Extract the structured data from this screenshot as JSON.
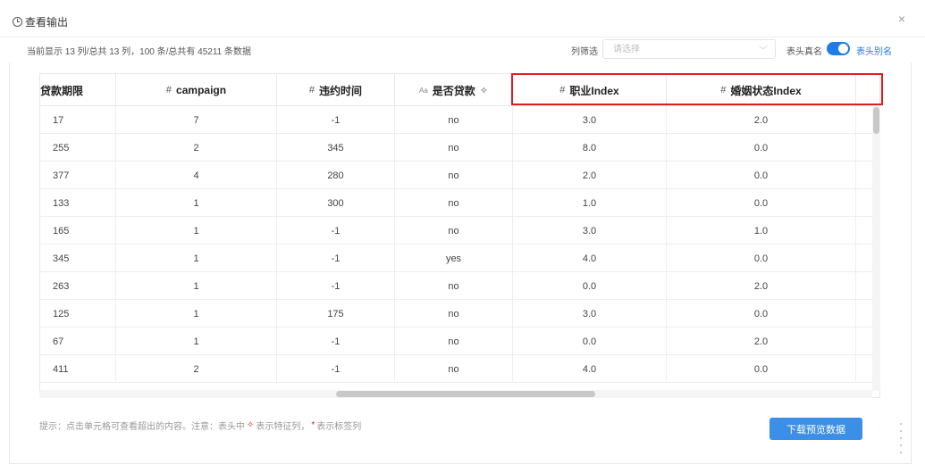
{
  "dialog": {
    "title": "查看输出",
    "close_label": "×"
  },
  "toolbar": {
    "summary": "当前显示 13 列/总共 13 列，100 条/总共有 45211 条数据",
    "column_filter_label": "列筛选",
    "column_filter_placeholder": "请选择",
    "real_name_label": "表头真名",
    "alias_label": "表头别名",
    "alias_toggle_on": true
  },
  "table": {
    "columns": [
      {
        "label": "贷款期限",
        "type_icon": ""
      },
      {
        "label": "campaign",
        "type_icon": "#"
      },
      {
        "label": "违约时间",
        "type_icon": "#"
      },
      {
        "label": "是否贷款",
        "type_icon": "Aa"
      },
      {
        "label": "职业Index",
        "type_icon": "#"
      },
      {
        "label": "婚姻状态Index",
        "type_icon": "#"
      }
    ],
    "rows": [
      [
        "17",
        "7",
        "-1",
        "no",
        "3.0",
        "2.0"
      ],
      [
        "255",
        "2",
        "345",
        "no",
        "8.0",
        "0.0"
      ],
      [
        "377",
        "4",
        "280",
        "no",
        "2.0",
        "0.0"
      ],
      [
        "133",
        "1",
        "300",
        "no",
        "1.0",
        "0.0"
      ],
      [
        "165",
        "1",
        "-1",
        "no",
        "3.0",
        "1.0"
      ],
      [
        "345",
        "1",
        "-1",
        "yes",
        "4.0",
        "0.0"
      ],
      [
        "263",
        "1",
        "-1",
        "no",
        "0.0",
        "2.0"
      ],
      [
        "125",
        "1",
        "175",
        "no",
        "3.0",
        "0.0"
      ],
      [
        "67",
        "1",
        "-1",
        "no",
        "0.0",
        "2.0"
      ],
      [
        "411",
        "2",
        "-1",
        "no",
        "4.0",
        "0.0"
      ]
    ]
  },
  "footer": {
    "hint_prefix": "提示：点击单元格可查看超出的内容。注意：表头中",
    "hint_feature": "表示特征列，",
    "hint_star": "*",
    "hint_label": "表示标签列",
    "download_label": "下载预览数据"
  },
  "colors": {
    "accent": "#1f7be6",
    "button": "#3c8fe6",
    "highlight": "#e11d1d"
  }
}
